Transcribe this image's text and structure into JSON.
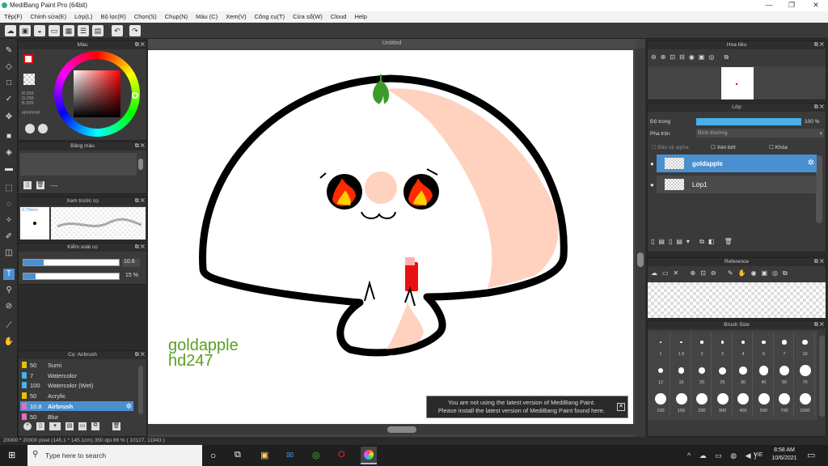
{
  "window": {
    "title": "MediBang Paint Pro (64bit)"
  },
  "menu": [
    "Tệp(F)",
    "Chỉnh sửa(E)",
    "Lớp(L)",
    "Bộ lọc(R)",
    "Chọn(S)",
    "Chụp(N)",
    "Màu (C)",
    "Xem(V)",
    "Công cụ(T)",
    "Cửa sổ(W)",
    "Cloud",
    "Help"
  ],
  "panels": {
    "color": {
      "title": "Màu",
      "r": "R:255",
      "g": "G:255",
      "b": "B:255",
      "hex": "#FFFFFF"
    },
    "palette": {
      "title": "Bảng màu",
      "dash": "---"
    },
    "preview": {
      "title": "Xem trước cọ",
      "size": "0.79mm"
    },
    "control": {
      "title": "Kiểm soát cọ",
      "size": "10.8",
      "opacity": "15 %",
      "size_fill": 0.21,
      "opacity_fill": 0.13
    },
    "brush": {
      "title": "Cọ: Airbrush",
      "items": [
        {
          "num": "50",
          "name": "Sumi",
          "color": "#e8c200"
        },
        {
          "num": "7",
          "name": "Watercolor",
          "color": "#4ab0e8"
        },
        {
          "num": "100",
          "name": "Watercolor (Wet)",
          "color": "#4ab0e8"
        },
        {
          "num": "50",
          "name": "Acrylic",
          "color": "#e8c200"
        },
        {
          "num": "10.8",
          "name": "Airbrush",
          "color": "#e070c0",
          "active": true
        },
        {
          "num": "50",
          "name": "Blur",
          "color": "#e070c0"
        }
      ]
    },
    "navigator": {
      "title": "Hoa tiêu"
    },
    "layers": {
      "title": "Lớp",
      "opacity_label": "Độ trong",
      "opacity_value": "100 %",
      "opacity_fill": 1.0,
      "blend_label": "Pha trộn",
      "blend_value": "Bình thường",
      "alpha": "Bảo vệ alpha",
      "clip": "Xén bớt",
      "lock": "Khóa",
      "items": [
        {
          "name": "goldapple",
          "active": true
        },
        {
          "name": "Lớp1",
          "active": false
        }
      ]
    },
    "reference": {
      "title": "Reference"
    },
    "brushsize": {
      "title": "Brush Size",
      "sizes": [
        "1",
        "1.5",
        "2",
        "3",
        "4",
        "5",
        "7",
        "10",
        "12",
        "15",
        "20",
        "25",
        "30",
        "40",
        "50",
        "70",
        "100",
        "150",
        "200",
        "300",
        "400",
        "500",
        "700",
        "1000"
      ]
    }
  },
  "canvas": {
    "title": "Untitled",
    "signature_line1": "goldapple",
    "signature_line2": "hd247"
  },
  "notice": {
    "line1": "You are not using the latest version of MediBang Paint.",
    "line2": "Please install the latest version of MediBang Paint found here."
  },
  "status": {
    "text": "20000 * 20000 pixel   (145.1 * 145.1cm)   350 dpi   66 %   ( 10127, 11943 )"
  },
  "taskbar": {
    "search_placeholder": "Type here to search",
    "time": "8:58 AM",
    "date": "10/6/2021",
    "lang": "VIE"
  },
  "colors": {
    "accent": "#4a90d0",
    "green_text": "#5aa020",
    "peach": "#ffd2bf"
  }
}
